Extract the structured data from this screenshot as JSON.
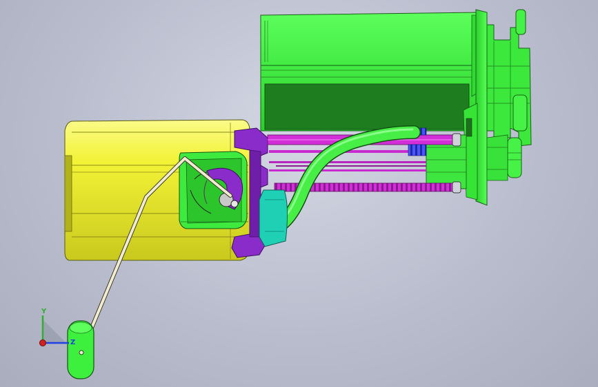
{
  "viewport": {
    "background_top": "#d4d7e3",
    "background_bottom": "#a9adbd"
  },
  "colors": {
    "canister_green": "#3df53d",
    "canister_dark": "#1f7a1f",
    "pump_yellow": "#f4f43a",
    "pump_yellow_dark": "#9a9a1c",
    "magenta_tube": "#d22fd8",
    "purple_part": "#8a2cc9",
    "blue_clips": "#3640e8",
    "teal_part": "#1fd0b4",
    "float_arm": "#f0ecd2",
    "outline": "#202020"
  },
  "triad": {
    "y_label": "Y",
    "z_label": "Z",
    "x_axis_color": "#d62020",
    "y_axis_color": "#2fb02f",
    "z_axis_color": "#2040e0"
  }
}
